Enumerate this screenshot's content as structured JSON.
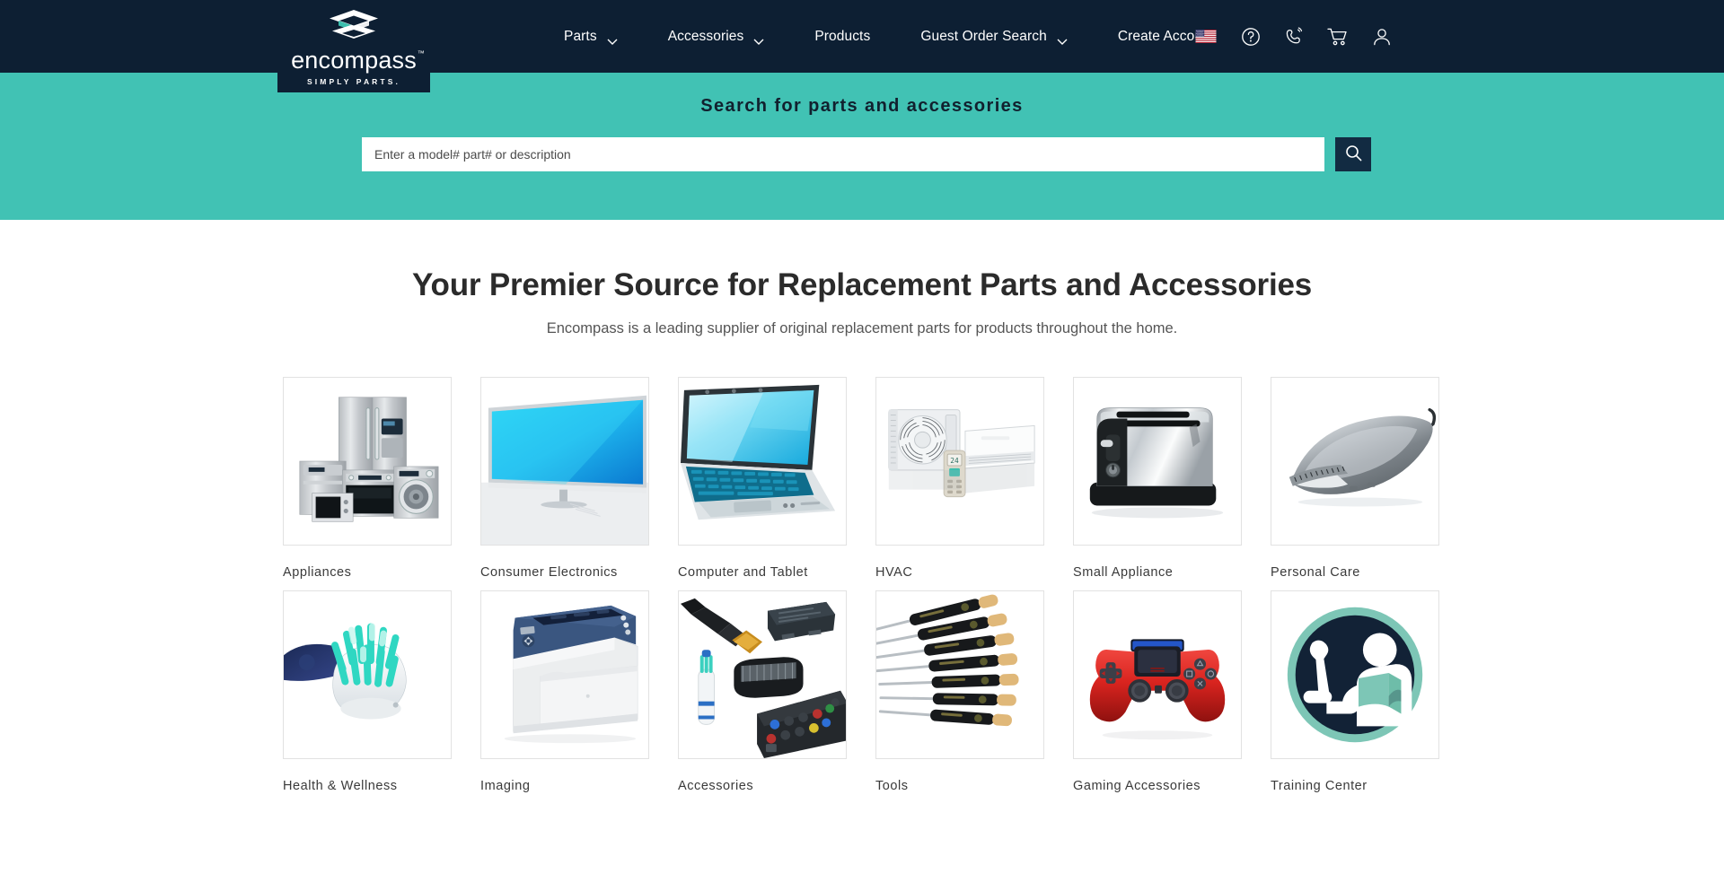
{
  "brand": {
    "name": "encompass",
    "tagline": "SIMPLY PARTS.",
    "trademark": "™",
    "navy": "#0d1f33",
    "teal": "#41c2b4"
  },
  "nav": {
    "items": [
      {
        "label": "Parts",
        "has_caret": true,
        "icon": "chevron-down-icon"
      },
      {
        "label": "Accessories",
        "has_caret": true,
        "icon": "chevron-down-icon"
      },
      {
        "label": "Products",
        "has_caret": false,
        "icon": ""
      },
      {
        "label": "Guest Order Search",
        "has_caret": true,
        "icon": "chevron-down-icon"
      },
      {
        "label": "Create Account",
        "has_caret": false,
        "icon": ""
      }
    ]
  },
  "header_icons": [
    {
      "name": "us-flag-icon",
      "label": "United States"
    },
    {
      "name": "help-circle-icon",
      "label": "Help"
    },
    {
      "name": "phone-call-icon",
      "label": "Contact"
    },
    {
      "name": "shopping-cart-icon",
      "label": "Cart"
    },
    {
      "name": "user-account-icon",
      "label": "Account"
    }
  ],
  "search": {
    "title": "Search for parts and accessories",
    "placeholder": "Enter a model# part# or description",
    "value": "",
    "button_icon": "search-icon"
  },
  "main": {
    "title": "Your Premier Source for Replacement Parts and Accessories",
    "subtitle": "Encompass is a leading supplier of original replacement parts for products throughout the home."
  },
  "categories": [
    {
      "label": "Appliances",
      "image": "appliances-photo"
    },
    {
      "label": "Consumer Electronics",
      "image": "television-photo"
    },
    {
      "label": "Computer and Tablet",
      "image": "laptop-photo"
    },
    {
      "label": "HVAC",
      "image": "air-conditioner-photo"
    },
    {
      "label": "Small Appliance",
      "image": "toaster-photo"
    },
    {
      "label": "Personal Care",
      "image": "hair-clipper-photo"
    },
    {
      "label": "Health & Wellness",
      "image": "toothbrush-head-photo"
    },
    {
      "label": "Imaging",
      "image": "printer-photo"
    },
    {
      "label": "Accessories",
      "image": "accessories-photo"
    },
    {
      "label": "Tools",
      "image": "screwdriver-set-photo"
    },
    {
      "label": "Gaming Accessories",
      "image": "game-controller-photo"
    },
    {
      "label": "Training Center",
      "image": "training-center-badge"
    }
  ]
}
